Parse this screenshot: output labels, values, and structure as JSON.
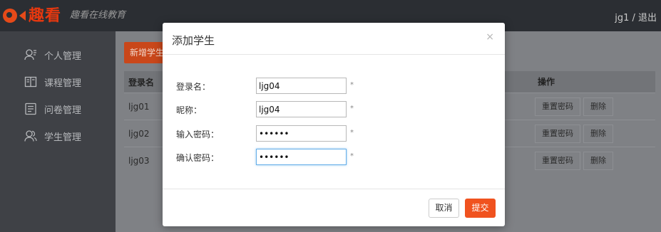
{
  "header": {
    "logo_text": "趣看",
    "slogan": "趣看在线教育",
    "user_area": "jg1 / 退出"
  },
  "sidebar": {
    "items": [
      {
        "label": "个人管理",
        "icon": "user-icon"
      },
      {
        "label": "课程管理",
        "icon": "book-icon"
      },
      {
        "label": "问卷管理",
        "icon": "survey-icon"
      },
      {
        "label": "学生管理",
        "icon": "students-icon"
      }
    ]
  },
  "main": {
    "add_button_label": "新增学生",
    "table": {
      "headers": {
        "login": "登录名",
        "ops": "操作"
      },
      "rows": [
        {
          "login": "ljg01"
        },
        {
          "login": "ljg02"
        },
        {
          "login": "ljg03"
        }
      ],
      "reset_label": "重置密码",
      "delete_label": "删除"
    }
  },
  "modal": {
    "title": "添加学生",
    "close": "×",
    "fields": {
      "login": {
        "label": "登录名：",
        "value": "ljg04",
        "required": "*"
      },
      "nickname": {
        "label": "昵称：",
        "value": "ljg04",
        "required": "*"
      },
      "password": {
        "label": "输入密码：",
        "value": "••••••",
        "required": "*"
      },
      "confirm": {
        "label": "确认密码：",
        "value": "••••••",
        "required": "*"
      }
    },
    "cancel_label": "取消",
    "submit_label": "提交"
  },
  "colors": {
    "brand": "#e64a19",
    "submit": "#f0521f",
    "topbar": "#2b2e33",
    "sidebar": "#3f4146"
  }
}
